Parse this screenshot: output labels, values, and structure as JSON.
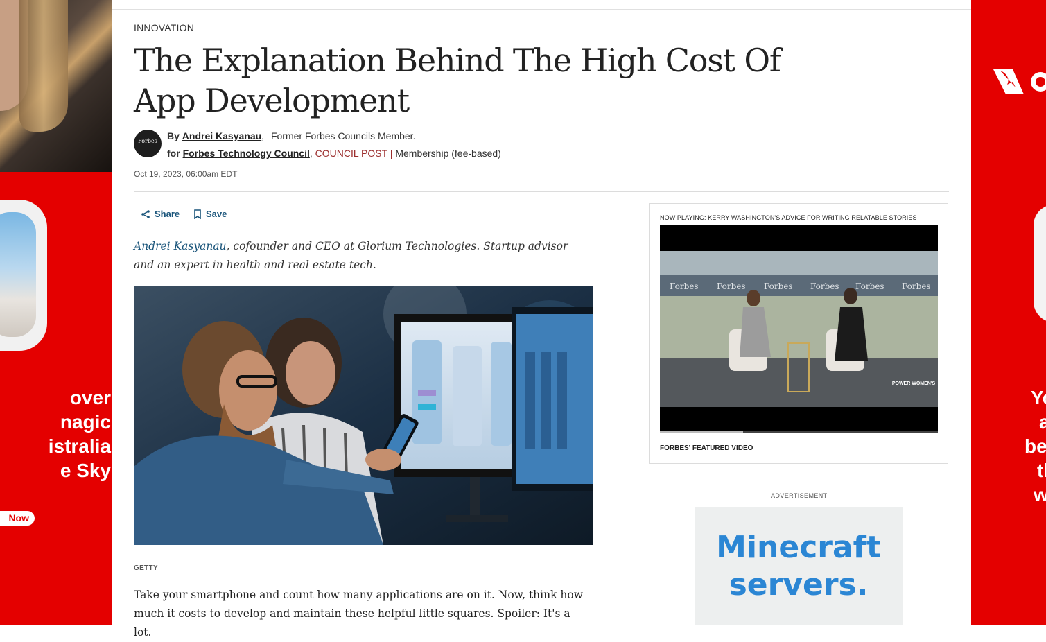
{
  "left_ad": {
    "headline_lines": [
      "over",
      "nagic",
      "istralia",
      "e Sky"
    ],
    "cta": "Now",
    "brand_color": "#e40000"
  },
  "right_ad": {
    "lines": [
      "Yo",
      "a",
      "be",
      "th",
      "w"
    ]
  },
  "article": {
    "section": "INNOVATION",
    "title": "The Explanation Behind The High Cost Of App Development",
    "avatar_text": "Forbes",
    "by_prefix": "By",
    "author": "Andrei Kasyanau",
    "author_role": "Former Forbes Councils Member.",
    "for_prefix": "for",
    "council": "Forbes Technology Council",
    "post_type": "COUNCIL POST",
    "separator": "|",
    "membership": "Membership (fee-based)",
    "date": "Oct 19, 2023, 06:00am EDT",
    "share_label": "Share",
    "save_label": "Save",
    "intro_author": "Andrei Kasyanau",
    "intro_rest": ", cofounder and CEO at Glorium Technologies. Startup advisor and an expert in health and real estate tech.",
    "image_credit": "GETTY",
    "first_paragraph": "Take your smartphone and count how many applications are on it. Now, think how much it costs to develop and maintain these helpful little squares. Spoiler: It's a lot."
  },
  "video": {
    "now_playing": "NOW PLAYING: KERRY WASHINGTON'S ADVICE FOR WRITING RELATABLE STORIES",
    "banner_word": "Forbes",
    "summit_text": "POWER WOMEN'S",
    "label": "FORBES' FEATURED VIDEO",
    "progress": 0.3
  },
  "ad": {
    "label": "ADVERTISEMENT",
    "text_line1": "Minecraft",
    "text_line2": "servers.",
    "color": "#2b86d4"
  }
}
